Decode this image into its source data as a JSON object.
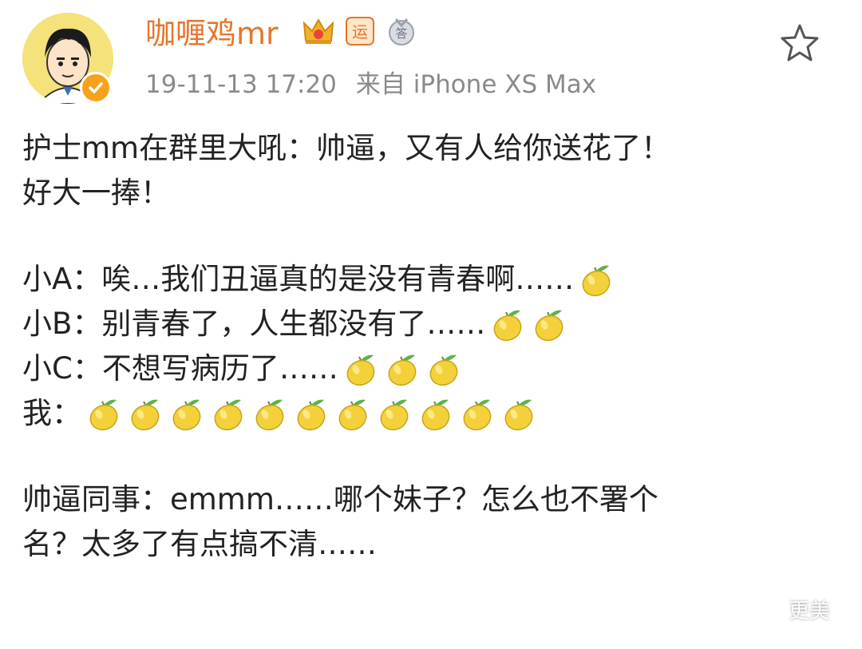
{
  "header": {
    "username": "咖喱鸡mr",
    "timestamp": "19-11-13 17:20",
    "source": "来自 iPhone XS Max",
    "badges": [
      "crown-icon",
      "yun-badge-icon",
      "medal-icon"
    ],
    "badge_texts": {
      "yun": "运",
      "medal": "答"
    }
  },
  "post": {
    "lines": [
      {
        "text": "护士mm在群里大吼：帅逼，又有人给你送花了！",
        "lemons": 0
      },
      {
        "text": "好大一捧！",
        "lemons": 0
      },
      {
        "text": "",
        "lemons": 0
      },
      {
        "text": "小A：唉…我们丑逼真的是没有青春啊……",
        "lemons": 1
      },
      {
        "text": "小B：别青春了，人生都没有了……",
        "lemons": 2
      },
      {
        "text": "小C：不想写病历了……",
        "lemons": 3
      },
      {
        "text": "我：",
        "lemons": 11
      },
      {
        "text": "",
        "lemons": 0
      },
      {
        "text": "帅逼同事：emmm……哪个妹子？怎么也不署个",
        "lemons": 0
      },
      {
        "text": "名？太多了有点搞不清……",
        "lemons": 0
      }
    ]
  },
  "watermark": {
    "text": "更美"
  },
  "colors": {
    "username": "#e8742c",
    "meta": "#8a8a8a",
    "verified": "#f7a21b",
    "lemon": "#f4d13a"
  }
}
